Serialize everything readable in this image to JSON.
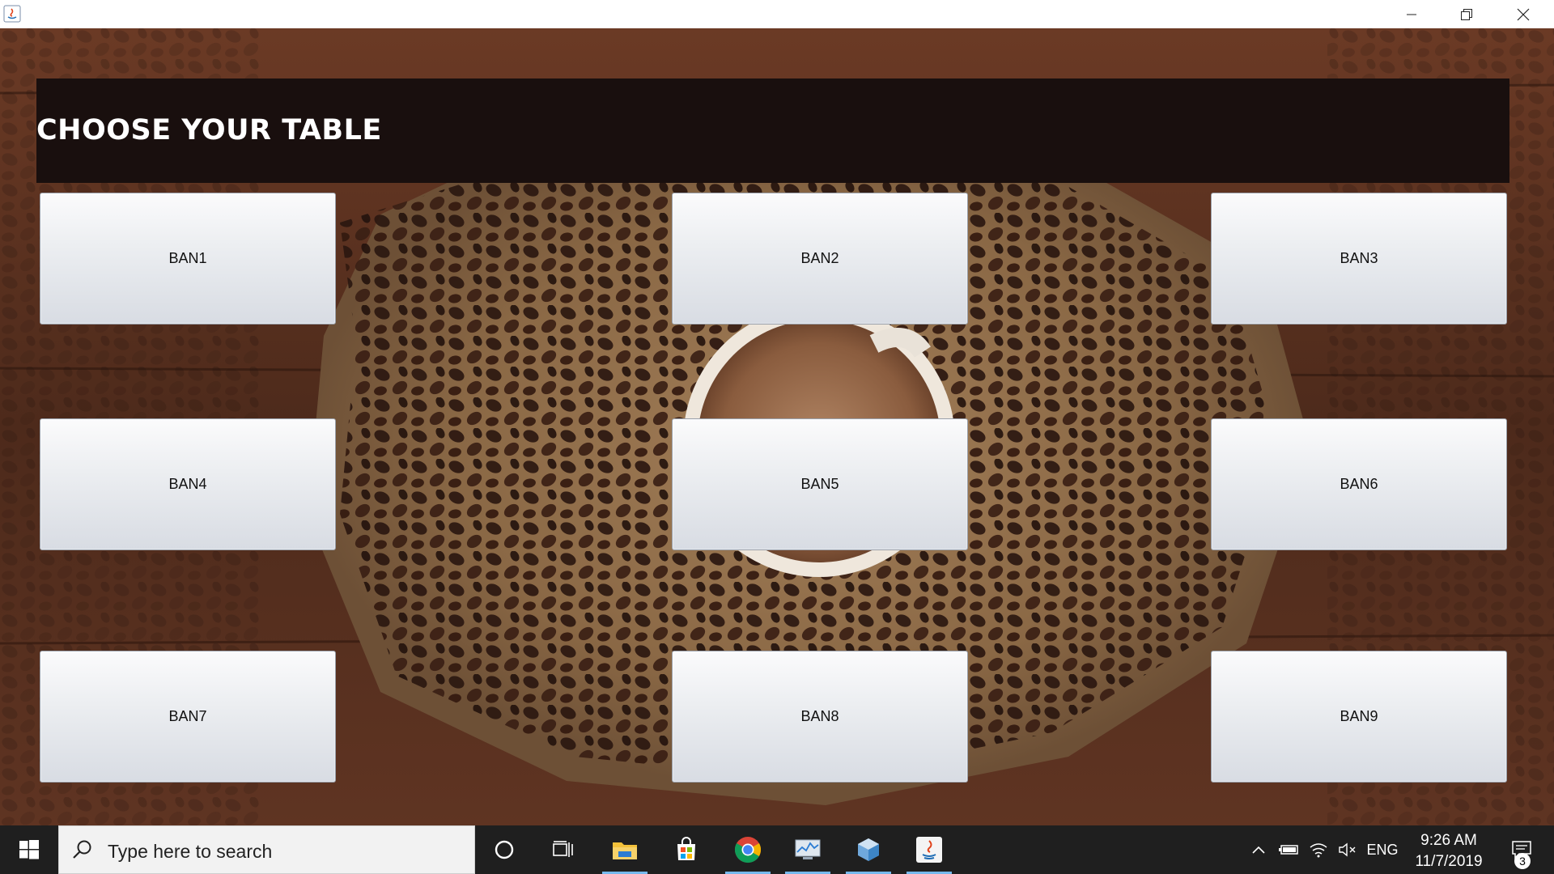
{
  "header": {
    "title": "CHOOSE YOUR TABLE"
  },
  "tables": [
    "BAN1",
    "BAN2",
    "BAN3",
    "BAN4",
    "BAN5",
    "BAN6",
    "BAN7",
    "BAN8",
    "BAN9"
  ],
  "window_controls": {
    "icons": [
      "minimize-icon",
      "restore-icon",
      "close-icon"
    ]
  },
  "taskbar": {
    "search_placeholder": "Type here to search",
    "apps": [
      "cortana-icon",
      "task-view-icon",
      "file-explorer-icon",
      "microsoft-store-icon",
      "chrome-icon",
      "performance-monitor-icon",
      "virtualbox-icon",
      "java-icon"
    ],
    "tray": {
      "language": "ENG",
      "time": "9:26 AM",
      "date": "11/7/2019",
      "notification_count": "3"
    }
  },
  "colors": {
    "header_band": "#190f0e",
    "wood": "#5a3220",
    "burlap": "#9a7651",
    "taskbar": "#1f1f1f",
    "accent": "#76b9ed"
  }
}
